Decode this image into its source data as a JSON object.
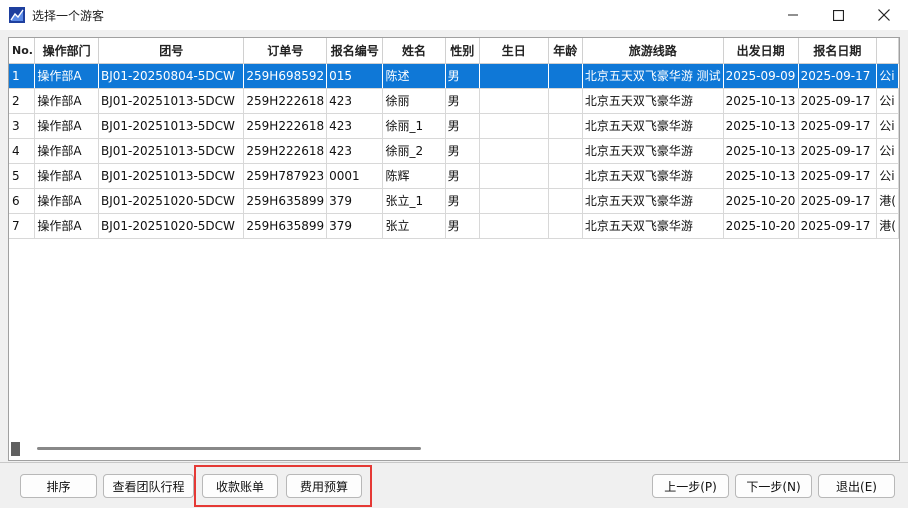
{
  "window": {
    "title": "选择一个游客"
  },
  "table": {
    "columns": [
      "No.",
      "操作部门",
      "团号",
      "订单号",
      "报名编号",
      "姓名",
      "性别",
      "生日",
      "年龄",
      "旅游线路",
      "出发日期",
      "报名日期",
      ""
    ],
    "rows": [
      [
        "1",
        "操作部A",
        "BJ01-20250804-5DCW",
        "259H698592",
        "015",
        "陈述",
        "男",
        "",
        "",
        "北京五天双飞豪华游 测试",
        "2025-09-09",
        "2025-09-17",
        "公i"
      ],
      [
        "2",
        "操作部A",
        "BJ01-20251013-5DCW",
        "259H222618",
        "423",
        "徐丽",
        "男",
        "",
        "",
        "北京五天双飞豪华游",
        "2025-10-13",
        "2025-09-17",
        "公i"
      ],
      [
        "3",
        "操作部A",
        "BJ01-20251013-5DCW",
        "259H222618",
        "423",
        "徐丽_1",
        "男",
        "",
        "",
        "北京五天双飞豪华游",
        "2025-10-13",
        "2025-09-17",
        "公i"
      ],
      [
        "4",
        "操作部A",
        "BJ01-20251013-5DCW",
        "259H222618",
        "423",
        "徐丽_2",
        "男",
        "",
        "",
        "北京五天双飞豪华游",
        "2025-10-13",
        "2025-09-17",
        "公i"
      ],
      [
        "5",
        "操作部A",
        "BJ01-20251013-5DCW",
        "259H787923",
        "0001",
        "陈辉",
        "男",
        "",
        "",
        "北京五天双飞豪华游",
        "2025-10-13",
        "2025-09-17",
        "公i"
      ],
      [
        "6",
        "操作部A",
        "BJ01-20251020-5DCW",
        "259H635899",
        "379",
        "张立_1",
        "男",
        "",
        "",
        "北京五天双飞豪华游",
        "2025-10-20",
        "2025-09-17",
        "港("
      ],
      [
        "7",
        "操作部A",
        "BJ01-20251020-5DCW",
        "259H635899",
        "379",
        "张立",
        "男",
        "",
        "",
        "北京五天双飞豪华游",
        "2025-10-20",
        "2025-09-17",
        "港("
      ]
    ],
    "selected_row": 0
  },
  "buttons": {
    "sort": "排序",
    "view_itinerary": "查看团队行程",
    "receipt_bill": "收款账单",
    "cost_budget": "费用预算",
    "prev": "上一步(P)",
    "next": "下一步(N)",
    "exit": "退出(E)"
  },
  "colors": {
    "selection": "#0f78d7",
    "highlight": "#e53935"
  },
  "icons": {
    "app": "app-logo-icon",
    "minimize": "minimize-icon",
    "maximize": "maximize-icon",
    "close": "close-icon"
  }
}
